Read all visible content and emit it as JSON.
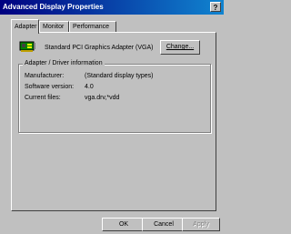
{
  "window": {
    "title": "Advanced Display Properties",
    "help_label": "?"
  },
  "tabs": [
    {
      "label": "Adapter"
    },
    {
      "label": "Monitor"
    },
    {
      "label": "Performance"
    }
  ],
  "adapter": {
    "name": "Standard PCI Graphics Adapter (VGA)",
    "change_label": "Change...",
    "icon": "video-card-icon"
  },
  "driver_info": {
    "title": "Adapter / Driver information",
    "rows": [
      {
        "label": "Manufacturer:",
        "value": "(Standard display types)"
      },
      {
        "label": "Software version:",
        "value": "4.0"
      },
      {
        "label": "Current files:",
        "value": "vga.drv,*vdd"
      }
    ]
  },
  "buttons": {
    "ok": "OK",
    "cancel": "Cancel",
    "apply": "Apply"
  }
}
